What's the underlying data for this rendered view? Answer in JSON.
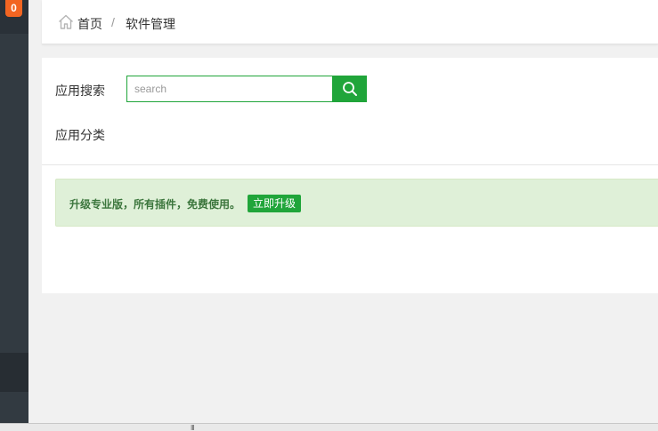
{
  "sidebar": {
    "badge": "0"
  },
  "breadcrumb": {
    "home_icon": "home-icon",
    "home": "首页",
    "separator": "/",
    "current": "软件管理"
  },
  "search": {
    "label": "应用搜索",
    "placeholder": "search",
    "value": "",
    "button_icon": "search-icon"
  },
  "category": {
    "label": "应用分类"
  },
  "alert": {
    "text": "升级专业版，所有插件，免费使用。",
    "button_label": "立即升级"
  },
  "scrollbar": {
    "grip": "III"
  },
  "colors": {
    "accent": "#20a53a",
    "sidebar": "#323a41",
    "badge": "#f26522",
    "alert_bg": "#dff0d8",
    "alert_text": "#3c763d"
  }
}
